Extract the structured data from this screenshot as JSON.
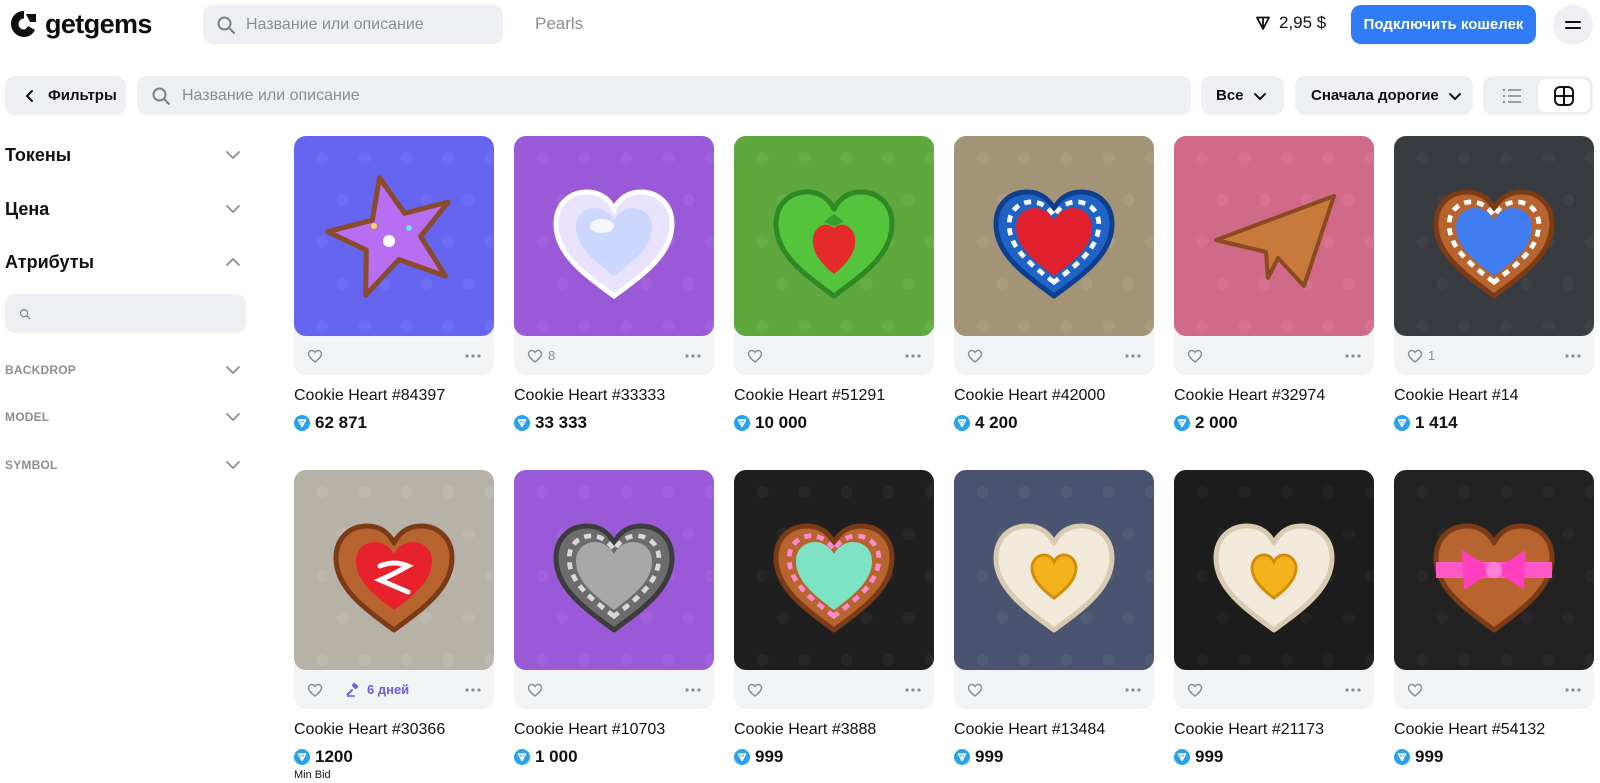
{
  "brand": {
    "name": "getgems"
  },
  "header": {
    "search_placeholder": "Название или описание",
    "collection": "Pearls",
    "balance": "2,95 $",
    "connect_label": "Подключить кошелек"
  },
  "toolbar": {
    "filters_label": "Фильтры",
    "search_placeholder": "Название или описание",
    "status_filter": "Все",
    "sort": "Сначала дорогие",
    "view_mode": "grid"
  },
  "sidebar": {
    "sections": [
      "Токены",
      "Цена",
      "Атрибуты"
    ],
    "attributes": [
      "BACKDROP",
      "MODEL",
      "SYMBOL"
    ]
  },
  "colors": {
    "accent": "#2f7cf6",
    "ton": "#2aa3ee",
    "auction": "#6c5ce7"
  },
  "items": [
    {
      "name": "Cookie Heart #84397",
      "price": "62 871",
      "likes": "",
      "bg": "#6565ef",
      "art": "star"
    },
    {
      "name": "Cookie Heart #33333",
      "price": "33 333",
      "likes": "8",
      "bg": "#9a5ad8",
      "art": "pearl-heart"
    },
    {
      "name": "Cookie Heart #51291",
      "price": "10 000",
      "likes": "",
      "bg": "#5ea83e",
      "art": "strawberry-heart"
    },
    {
      "name": "Cookie Heart #42000",
      "price": "4 200",
      "likes": "",
      "bg": "#a39377",
      "art": "blue-red-heart"
    },
    {
      "name": "Cookie Heart #32974",
      "price": "2 000",
      "likes": "",
      "bg": "#cf6a88",
      "art": "plane"
    },
    {
      "name": "Cookie Heart #14",
      "price": "1 414",
      "likes": "1",
      "bg": "#383b40",
      "art": "blue-heart"
    },
    {
      "name": "Cookie Heart #30366",
      "price": "1200",
      "likes": "",
      "bg": "#b6b2a8",
      "art": "red-heart",
      "auction": "6 дней",
      "min_bid": "Min Bid"
    },
    {
      "name": "Cookie Heart #10703",
      "price": "1 000",
      "likes": "",
      "bg": "#9a5ad8",
      "art": "silver-heart"
    },
    {
      "name": "Cookie Heart #3888",
      "price": "999",
      "likes": "",
      "bg": "#1f1f1f",
      "art": "rainbow-heart"
    },
    {
      "name": "Cookie Heart #13484",
      "price": "999",
      "likes": "",
      "bg": "#4a5470",
      "art": "egg-heart"
    },
    {
      "name": "Cookie Heart #21173",
      "price": "999",
      "likes": "",
      "bg": "#1c1c1c",
      "art": "egg-heart"
    },
    {
      "name": "Cookie Heart #54132",
      "price": "999",
      "likes": "",
      "bg": "#222222",
      "art": "bow-heart"
    }
  ]
}
